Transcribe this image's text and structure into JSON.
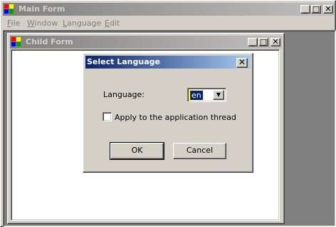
{
  "main_window": {
    "title": "Main Form",
    "controls": {
      "minimize": "_",
      "maximize": "□",
      "close": "✕"
    }
  },
  "menu": [
    {
      "label": "File",
      "mnemonic": "F"
    },
    {
      "label": "Window",
      "mnemonic": "W"
    },
    {
      "label": "Language",
      "mnemonic": "L"
    },
    {
      "label": "Edit",
      "mnemonic": "E"
    }
  ],
  "child_window": {
    "title": "Child Form",
    "controls": {
      "minimize": "_",
      "maximize": "□",
      "close": "✕"
    }
  },
  "dialog": {
    "title": "Select Language",
    "close": "✕",
    "language_label": "Language:",
    "language_value": "en",
    "apply_label": "Apply to the application thread",
    "apply_checked": false,
    "ok_label": "OK",
    "cancel_label": "Cancel"
  },
  "colors": {
    "active_caption_start": "#0a246a",
    "active_caption_end": "#a6caf0",
    "inactive_caption_start": "#808080",
    "inactive_caption_end": "#c0c0c0",
    "face": "#d4d0c8",
    "mdi_background": "#808080"
  }
}
